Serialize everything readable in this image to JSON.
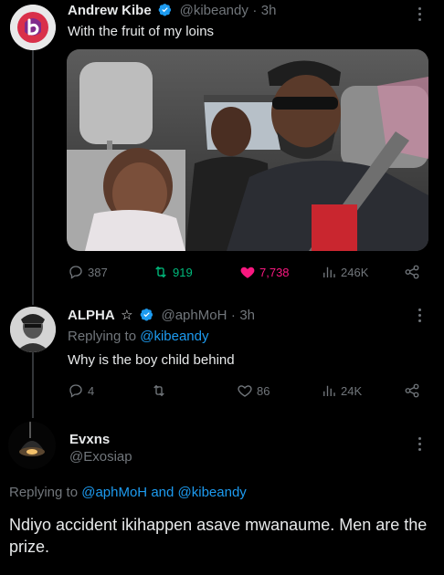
{
  "tweet1": {
    "name": "Andrew Kibe",
    "handle": "@kibeandy",
    "sep": "·",
    "time": "3h",
    "text": "With the fruit of my loins",
    "replies": "387",
    "retweets": "919",
    "likes": "7,738",
    "views": "246K"
  },
  "tweet2": {
    "name": "ALPHA",
    "star": "☆",
    "handle": "@aphMoH",
    "sep": "·",
    "time": "3h",
    "replying_prefix": "Replying to",
    "replying_to": "@kibeandy",
    "text": "Why is the boy child behind",
    "replies": "4",
    "retweets": "",
    "likes": "86",
    "views": "24K"
  },
  "tweet3": {
    "name": "Evxns",
    "handle": "@Exosiap",
    "replying_prefix": "Replying to",
    "replying_to_1": "@aphMoH",
    "replying_and": "and",
    "replying_to_2": "@kibeandy",
    "text": "Ndiyo accident ikihappen asave mwanaume. Men are the prize."
  },
  "colors": {
    "background": "#000000",
    "text": "#e7e9ea",
    "muted": "#71767b",
    "link_blue": "#1d9bf0",
    "retweet_green": "#00ba7c",
    "like_pink": "#f91880"
  }
}
